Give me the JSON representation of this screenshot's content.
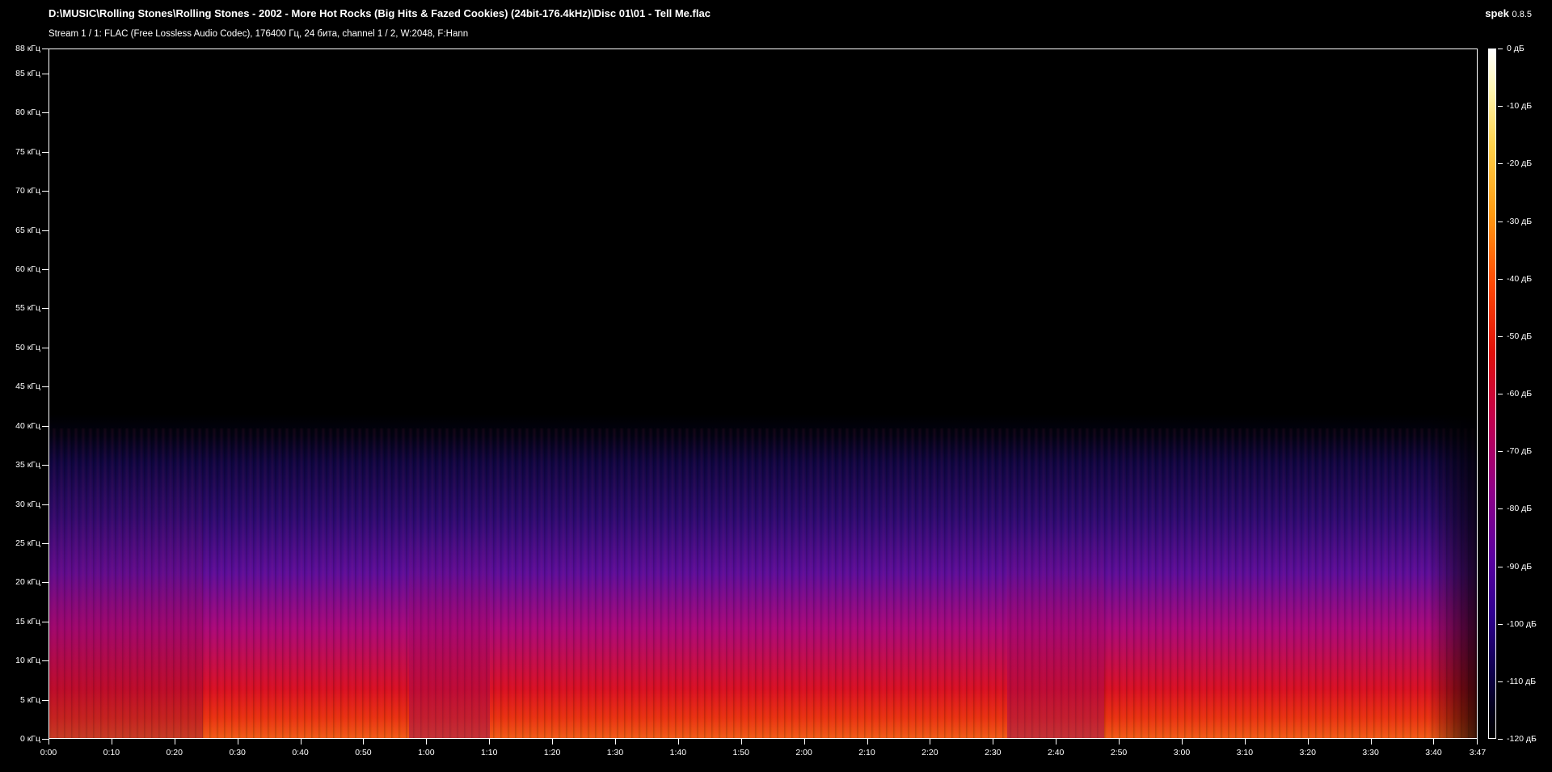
{
  "title": "D:\\MUSIC\\Rolling Stones\\Rolling Stones - 2002 - More Hot Rocks (Big Hits & Fazed Cookies) (24bit-176.4kHz)\\Disc 01\\01 - Tell Me.flac",
  "subtitle": "Stream 1 / 1: FLAC (Free Lossless Audio Codec), 176400 Гц, 24 бита, channel 1 / 2, W:2048, F:Hann",
  "app": {
    "name": "spek",
    "version": "0.8.5"
  },
  "y_axis": {
    "labels": [
      "88 кГц",
      "85 кГц",
      "80 кГц",
      "75 кГц",
      "70 кГц",
      "65 кГц",
      "60 кГц",
      "55 кГц",
      "50 кГц",
      "45 кГц",
      "40 кГц",
      "35 кГц",
      "30 кГц",
      "25 кГц",
      "20 кГц",
      "15 кГц",
      "10 кГц",
      "5 кГц",
      "0 кГц"
    ],
    "values_khz": [
      88.2,
      85,
      80,
      75,
      70,
      65,
      60,
      55,
      50,
      45,
      40,
      35,
      30,
      25,
      20,
      15,
      10,
      5,
      0
    ],
    "max_khz": 88.2
  },
  "x_axis": {
    "labels": [
      "0:00",
      "0:10",
      "0:20",
      "0:30",
      "0:40",
      "0:50",
      "1:00",
      "1:10",
      "1:20",
      "1:30",
      "1:40",
      "1:50",
      "2:00",
      "2:10",
      "2:20",
      "2:30",
      "2:40",
      "2:50",
      "3:00",
      "3:10",
      "3:20",
      "3:30",
      "3:40",
      "3:47"
    ],
    "values_sec": [
      0,
      10,
      20,
      30,
      40,
      50,
      60,
      70,
      80,
      90,
      100,
      110,
      120,
      130,
      140,
      150,
      160,
      170,
      180,
      190,
      200,
      210,
      220,
      227
    ],
    "duration_sec": 227
  },
  "colorbar": {
    "labels": [
      "0 дБ",
      "-10 дБ",
      "-20 дБ",
      "-30 дБ",
      "-40 дБ",
      "-50 дБ",
      "-60 дБ",
      "-70 дБ",
      "-80 дБ",
      "-90 дБ",
      "-100 дБ",
      "-110 дБ",
      "-120 дБ"
    ],
    "values_db": [
      0,
      -10,
      -20,
      -30,
      -40,
      -50,
      -60,
      -70,
      -80,
      -90,
      -100,
      -110,
      -120
    ]
  }
}
